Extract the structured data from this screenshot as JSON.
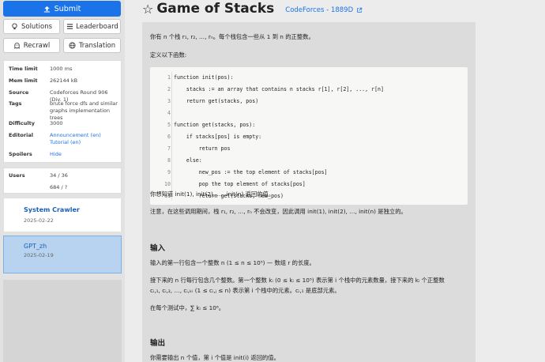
{
  "sidebar": {
    "submit_label": "Submit",
    "solutions_label": "Solutions",
    "leaderboard_label": "Leaderboard",
    "recrawl_label": "Recrawl",
    "translation_label": "Translation",
    "info": {
      "time_limit_label": "Time limit",
      "time_limit_value": "1000 ms",
      "mem_limit_label": "Mem limit",
      "mem_limit_value": "262144 kB",
      "source_label": "Source",
      "source_value": "Codeforces Round 906 (Div. 1)",
      "tags_label": "Tags",
      "tags_value": "brute force dfs and similar graphs implementation trees",
      "difficulty_label": "Difficulty",
      "difficulty_value": "3000",
      "editorial_label": "Editorial",
      "editorial_value": "Announcement (en) Tutorial (en)",
      "spoilers_label": "Spoilers",
      "spoilers_value": "Hide"
    },
    "users_label": "Users",
    "users_value1": "34 / 36",
    "users_value2": "684 / ?",
    "cards": [
      {
        "name": "System Crawler",
        "date": "2025-02-22"
      },
      {
        "name": "GPT_zh",
        "date": "2025-02-19"
      }
    ]
  },
  "header": {
    "title": "Game of Stacks",
    "source_link": "CodeForces - 1889D"
  },
  "content": {
    "intro": "你有 n 个栈 r₁, r₂, …, rₙ。每个栈包含一些从 1 到 n 的正整数。",
    "define": "定义以下函数:",
    "code_lines": [
      {
        "n": "1",
        "t": "function init(pos):"
      },
      {
        "n": "2",
        "t": "    stacks := an array that contains n stacks r[1], r[2], ..., r[n]"
      },
      {
        "n": "3",
        "t": "    return get(stacks, pos)"
      },
      {
        "n": "4",
        "t": ""
      },
      {
        "n": "5",
        "t": "function get(stacks, pos):"
      },
      {
        "n": "6",
        "t": "    if stacks[pos] is empty:"
      },
      {
        "n": "7",
        "t": "        return pos"
      },
      {
        "n": "8",
        "t": "    else:"
      },
      {
        "n": "9",
        "t": "        new_pos := the top element of stacks[pos]"
      },
      {
        "n": "10",
        "t": "        pop the top element of stacks[pos]"
      },
      {
        "n": "11",
        "t": "        return get(stacks, new_pos)"
      }
    ],
    "want": "你想知道 init(1), init(2), …, init(n) 返回的值。",
    "note": "注意，在这些调用期间，栈 r₁, r₂, …, rₙ 不会改变，因此调用 init(1), init(2), …, init(n) 是独立的。",
    "input_heading": "输入",
    "input_1": "输入的第一行包含一个整数 n (1 ≤ n ≤ 10⁵) — 数组 r 的长度。",
    "input_2": "接下来的 n 行每行包含几个整数。第一个整数 kᵢ (0 ≤ kᵢ ≤ 10⁵) 表示第 i 个栈中的元素数量，接下来的 kᵢ 个正整数",
    "input_3": "cᵢ,₁, cᵢ,₂, …, cᵢ,ₖᵢ (1 ≤ cᵢ,ⱼ ≤ n) 表示第 i 个栈中的元素。cᵢ,₁ 是底部元素。",
    "input_4": "在每个测试中，∑ kᵢ ≤ 10⁶。",
    "output_heading": "输出",
    "output_1": "你需要输出 n 个值，第 i 个值是 init(i) 返回的值。"
  }
}
